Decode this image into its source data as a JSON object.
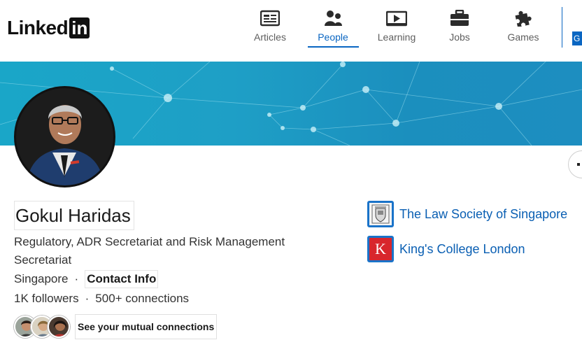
{
  "header": {
    "logo_text": "Linked",
    "logo_box": "in",
    "nav": [
      {
        "label": "Articles",
        "icon": "articles-icon"
      },
      {
        "label": "People",
        "icon": "people-icon",
        "active": true
      },
      {
        "label": "Learning",
        "icon": "learning-icon"
      },
      {
        "label": "Jobs",
        "icon": "jobs-icon"
      },
      {
        "label": "Games",
        "icon": "games-icon"
      }
    ],
    "cut_label": "G"
  },
  "colors": {
    "accent": "#0a66c2",
    "banner": "#1e9fc6",
    "link": "#0a5fb3"
  },
  "profile": {
    "name": "Gokul Haridas",
    "headline": "Regulatory, ADR Secretariat and Risk Management Secretariat",
    "location": "Singapore",
    "separator": "·",
    "contact_label": "Contact Info",
    "followers": "1K followers",
    "connections": "500+ connections",
    "mutual_label": "See your mutual connections"
  },
  "organizations": [
    {
      "name": "The Law Society of Singapore",
      "icon": "law-society-crest-icon"
    },
    {
      "name": "King's College London",
      "icon": "kings-college-logo-icon",
      "logo_letter": "K"
    }
  ]
}
